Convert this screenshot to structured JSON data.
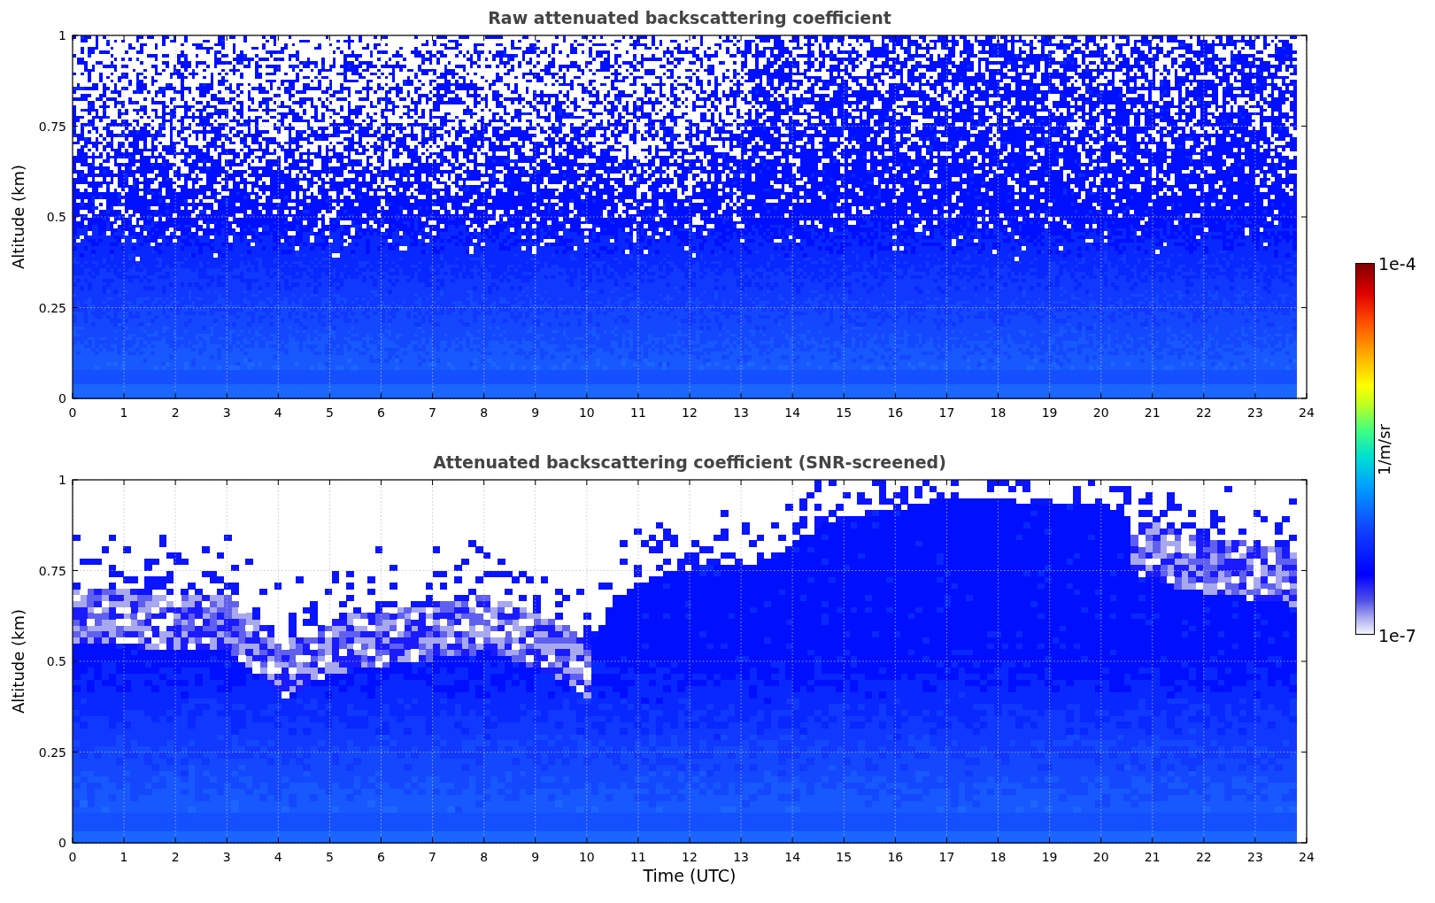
{
  "panels": [
    {
      "kind": "raw",
      "title": "Raw attenuated backscattering coefficient",
      "ylabel": "Altitude (km)",
      "yticks": [
        "1",
        "0.75",
        "0.5",
        "0.25",
        "0"
      ],
      "xticks": [
        "0",
        "1",
        "2",
        "3",
        "4",
        "5",
        "6",
        "7",
        "8",
        "9",
        "10",
        "11",
        "12",
        "13",
        "14",
        "15",
        "16",
        "17",
        "18",
        "19",
        "20",
        "21",
        "22",
        "23",
        "24"
      ]
    },
    {
      "kind": "screened",
      "title": "Attenuated backscattering coefficient (SNR-screened)",
      "ylabel": "Altitude (km)",
      "yticks": [
        "1",
        "0.75",
        "0.5",
        "0.25",
        "0"
      ],
      "xticks": [
        "0",
        "1",
        "2",
        "3",
        "4",
        "5",
        "6",
        "7",
        "8",
        "9",
        "10",
        "11",
        "12",
        "13",
        "14",
        "15",
        "16",
        "17",
        "18",
        "19",
        "20",
        "21",
        "22",
        "23",
        "24"
      ],
      "xlabel": "Time (UTC)"
    }
  ],
  "colorbar": {
    "max_label": "1e-4",
    "min_label": "1e-7",
    "unit": "1/m/sr"
  }
}
